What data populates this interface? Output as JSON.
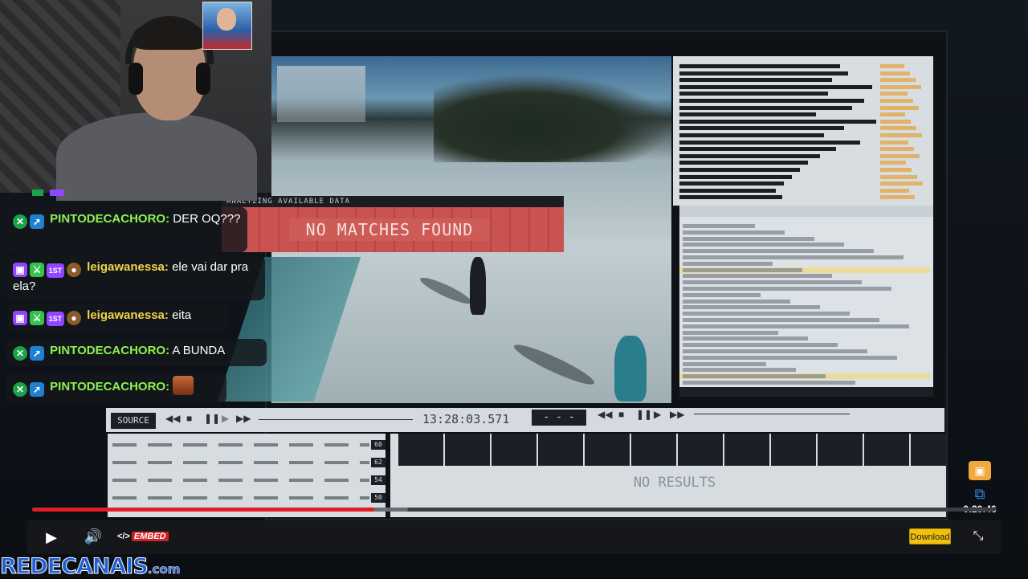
{
  "video": {
    "data_panel_title": "ANALYZING AVAILABLE DATA",
    "banner_text": "NO MATCHES FOUND",
    "source_label": "SOURCE",
    "timecode": "13:28:03.571",
    "dash_box": "- - -",
    "no_results": "NO RESULTS",
    "graph_numbers": [
      "60",
      "62",
      "54",
      "50"
    ]
  },
  "chat": {
    "messages": [
      {
        "user": "PINTODECACHORO:",
        "text": "DER OQ???"
      },
      {
        "user": "leigawanessa:",
        "text": "ele vai dar pra ela?"
      },
      {
        "user": "leigawanessa:",
        "text": "eita"
      },
      {
        "user": "PINTODECACHORO:",
        "text": "A BUNDA"
      },
      {
        "user": "PINTODECACHORO:",
        "text": ""
      }
    ],
    "badge_label": "1ST"
  },
  "player": {
    "current_time": "0:20:46",
    "progress": 0,
    "buffered_fraction": 0.39,
    "embed_label": "EMBED",
    "download_label": "Download"
  },
  "watermark": {
    "main": "REDECANAIS",
    "suffix": ".com"
  },
  "colors": {
    "progress": "#e21d25",
    "download": "#f2c10f",
    "user_green": "#8ef24f",
    "user_yellow": "#f2d64b",
    "watermark": "#1e5fd8"
  }
}
